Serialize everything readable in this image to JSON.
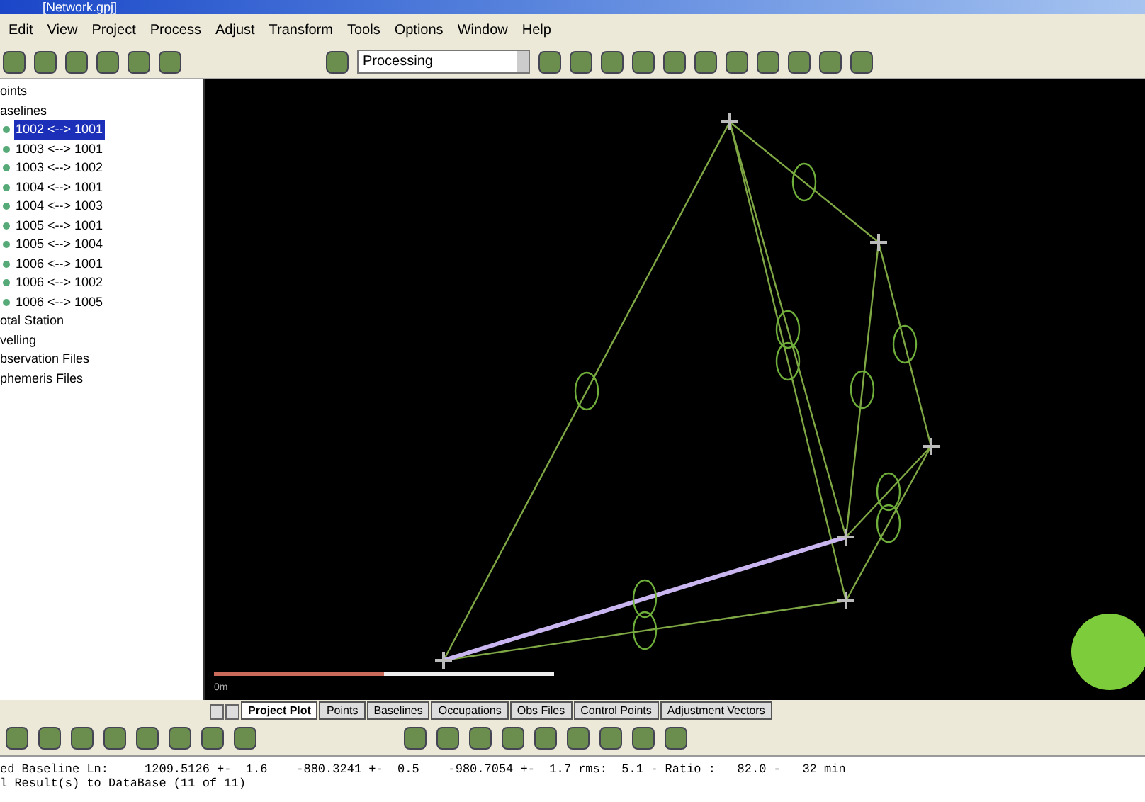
{
  "window": {
    "title": "[Network.gpj]"
  },
  "menu": [
    "Edit",
    "View",
    "Project",
    "Process",
    "Adjust",
    "Transform",
    "Tools",
    "Options",
    "Window",
    "Help"
  ],
  "toolbar": {
    "mode": "Processing"
  },
  "tree": [
    {
      "label": "oints"
    },
    {
      "label": "aselines",
      "children": [
        {
          "label": "1002 <--> 1001",
          "selected": true
        },
        {
          "label": "1003 <--> 1001",
          "selected": false
        },
        {
          "label": "1003 <--> 1002",
          "selected": false
        },
        {
          "label": "1004 <--> 1001",
          "selected": false
        },
        {
          "label": "1004 <--> 1003",
          "selected": false
        },
        {
          "label": "1005 <--> 1001",
          "selected": false
        },
        {
          "label": "1005 <--> 1004",
          "selected": false
        },
        {
          "label": "1006 <--> 1001",
          "selected": false
        },
        {
          "label": "1006 <--> 1002",
          "selected": false
        },
        {
          "label": "1006 <--> 1005",
          "selected": false
        }
      ]
    },
    {
      "label": "otal Station"
    },
    {
      "label": "velling"
    },
    {
      "label": "bservation Files"
    },
    {
      "label": "phemeris Files"
    }
  ],
  "plot": {
    "scale_label": "0m"
  },
  "tabs": [
    {
      "label": "Project Plot",
      "selected": true
    },
    {
      "label": "Points",
      "selected": false
    },
    {
      "label": "Baselines",
      "selected": false
    },
    {
      "label": "Occupations",
      "selected": false
    },
    {
      "label": "Obs Files",
      "selected": false
    },
    {
      "label": "Control Points",
      "selected": false
    },
    {
      "label": "Adjustment Vectors",
      "selected": false
    }
  ],
  "status_bar": [
    "ed Baseline Ln:     1209.5126 +-  1.6    -880.3241 +-  0.5    -980.7054 +-  1.7 rms:  5.1 - Ratio :   82.0 -   32 min",
    "l Result(s) to DataBase (11 of 11)"
  ]
}
